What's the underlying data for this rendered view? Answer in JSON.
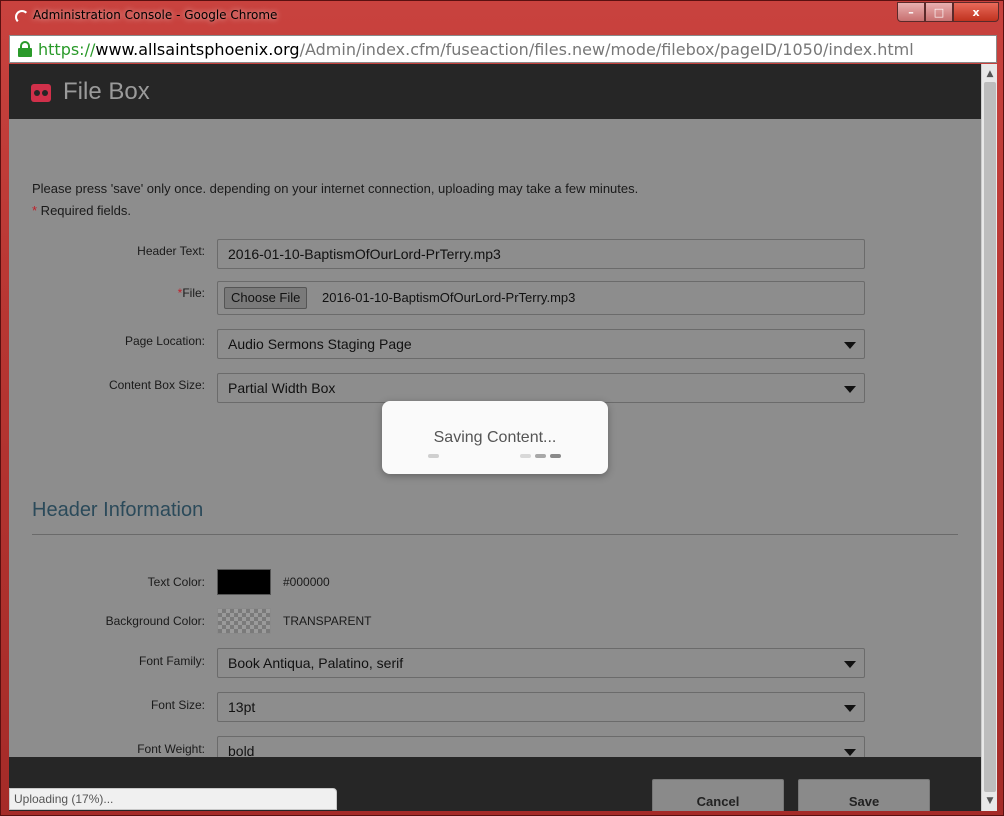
{
  "window": {
    "title": "Administration Console - Google Chrome",
    "controls": {
      "minimize": "–",
      "maximize": "□",
      "close": "x"
    }
  },
  "address_bar": {
    "scheme": "https://",
    "host": "www.allsaintsphoenix.org",
    "path": "/Admin/index.cfm/fuseaction/files.new/mode/filebox/pageID/1050/index.html"
  },
  "header": {
    "title": "File Box"
  },
  "form": {
    "notice": "Please press 'save' only once. depending on your internet connection, uploading may take a few minutes.",
    "required_star": "*",
    "required_text": " Required fields.",
    "header_text": {
      "label": "Header Text:",
      "value": "2016-01-10-BaptismOfOurLord-PrTerry.mp3"
    },
    "file": {
      "label_star": "*",
      "label": "File:",
      "button": "Choose File",
      "filename": "2016-01-10-BaptismOfOurLord-PrTerry.mp3"
    },
    "page_location": {
      "label": "Page Location:",
      "value": "Audio Sermons Staging Page"
    },
    "content_box_size": {
      "label": "Content Box Size:",
      "value": "Partial Width Box"
    }
  },
  "header_information": {
    "title": "Header Information",
    "text_color": {
      "label": "Text Color:",
      "value": "#000000"
    },
    "background_color": {
      "label": "Background Color:",
      "value": "TRANSPARENT"
    },
    "font_family": {
      "label": "Font Family:",
      "value": "Book Antiqua, Palatino, serif"
    },
    "font_size": {
      "label": "Font Size:",
      "value": "13pt"
    },
    "font_weight": {
      "label": "Font Weight:",
      "value": "bold"
    }
  },
  "footer": {
    "cancel": "Cancel",
    "save": "Save"
  },
  "status": {
    "text": "Uploading (17%)..."
  },
  "saving_modal": {
    "text": "Saving Content..."
  },
  "colors": {
    "accent_icon": "#d0304a",
    "section_title": "#2b4a5a",
    "dark_bar": "#262626"
  }
}
